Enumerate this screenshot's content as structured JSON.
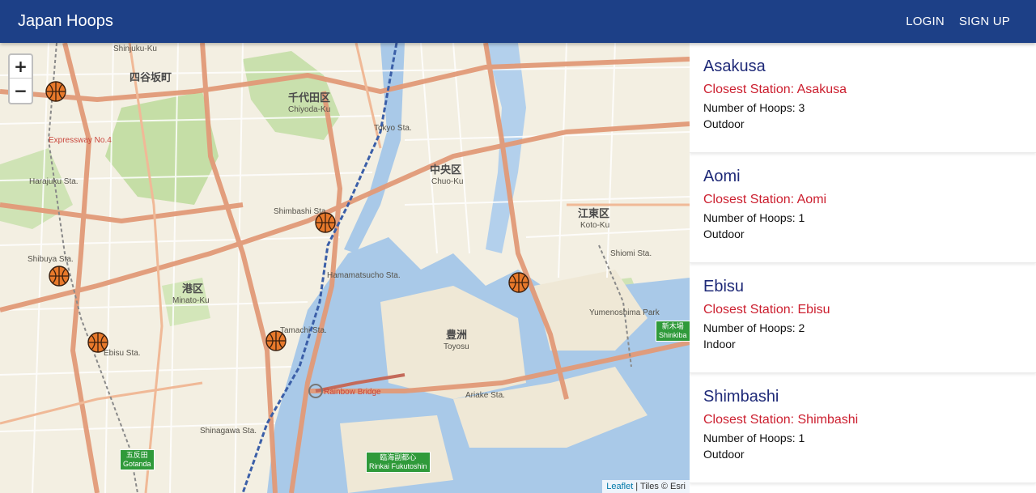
{
  "navbar": {
    "brand": "Japan Hoops",
    "links": [
      "LOGIN",
      "SIGN UP"
    ]
  },
  "map": {
    "zoom_in": "+",
    "zoom_out": "−",
    "attribution_link": "Leaflet",
    "attribution_text": " | Tiles © Esri",
    "labels": {
      "chiyoda_jp": "千代田区",
      "chiyoda_en": "Chiyoda-Ku",
      "chuo_jp": "中央区",
      "chuo_en": "Chuo-Ku",
      "koto_jp": "江東区",
      "koto_en": "Koto-Ku",
      "minato_jp": "港区",
      "minato_en": "Minato-Ku",
      "toyosu_jp": "豊洲",
      "toyosu_en": "Toyosu",
      "yotsuya": "四谷坂町",
      "shinjuku_ku": "Shinjuku-Ku",
      "tokyo_sta": "Tokyo Sta.",
      "shimbashi_sta": "Shimbashi Sta.",
      "hamamatsucho_sta": "Hamamatsucho Sta.",
      "tamachi_sta": "Tamachi Sta.",
      "shibuya_sta": "Shibuya Sta.",
      "ebisu_sta": "Ebisu Sta.",
      "harajuku_sta": "Harajuku Sta.",
      "shinagawa_sta": "Shinagawa Sta.",
      "shiomi_sta": "Shiomi Sta.",
      "rainbow_bridge": "Rainbow Bridge",
      "expressway": "Expressway No.4",
      "yumenoshima": "Yumenoshima Park",
      "ariake_sta": "Ariake Sta."
    },
    "signs": {
      "shinkiba": "新木場\nShinkiba",
      "gotanda": "五反田\nGotanda",
      "rinkai": "臨海副都心\nRinkai Fukutoshin"
    },
    "markers_icon": "basketball-icon"
  },
  "courts": [
    {
      "name": "Asakusa",
      "station": "Closest Station: Asakusa",
      "hoops": "Number of Hoops: 3",
      "type": "Outdoor"
    },
    {
      "name": "Aomi",
      "station": "Closest Station: Aomi",
      "hoops": "Number of Hoops: 1",
      "type": "Outdoor"
    },
    {
      "name": "Ebisu",
      "station": "Closest Station: Ebisu",
      "hoops": "Number of Hoops: 2",
      "type": "Indoor"
    },
    {
      "name": "Shimbashi",
      "station": "Closest Station: Shimbashi",
      "hoops": "Number of Hoops: 1",
      "type": "Outdoor"
    }
  ],
  "colors": {
    "navbar": "#1d4087",
    "court_title": "#1f2a78",
    "court_station": "#cc1f2f",
    "water": "#a9c9e8",
    "land": "#f3efe2",
    "road_major": "#e29a78",
    "park": "#c5dea6"
  }
}
